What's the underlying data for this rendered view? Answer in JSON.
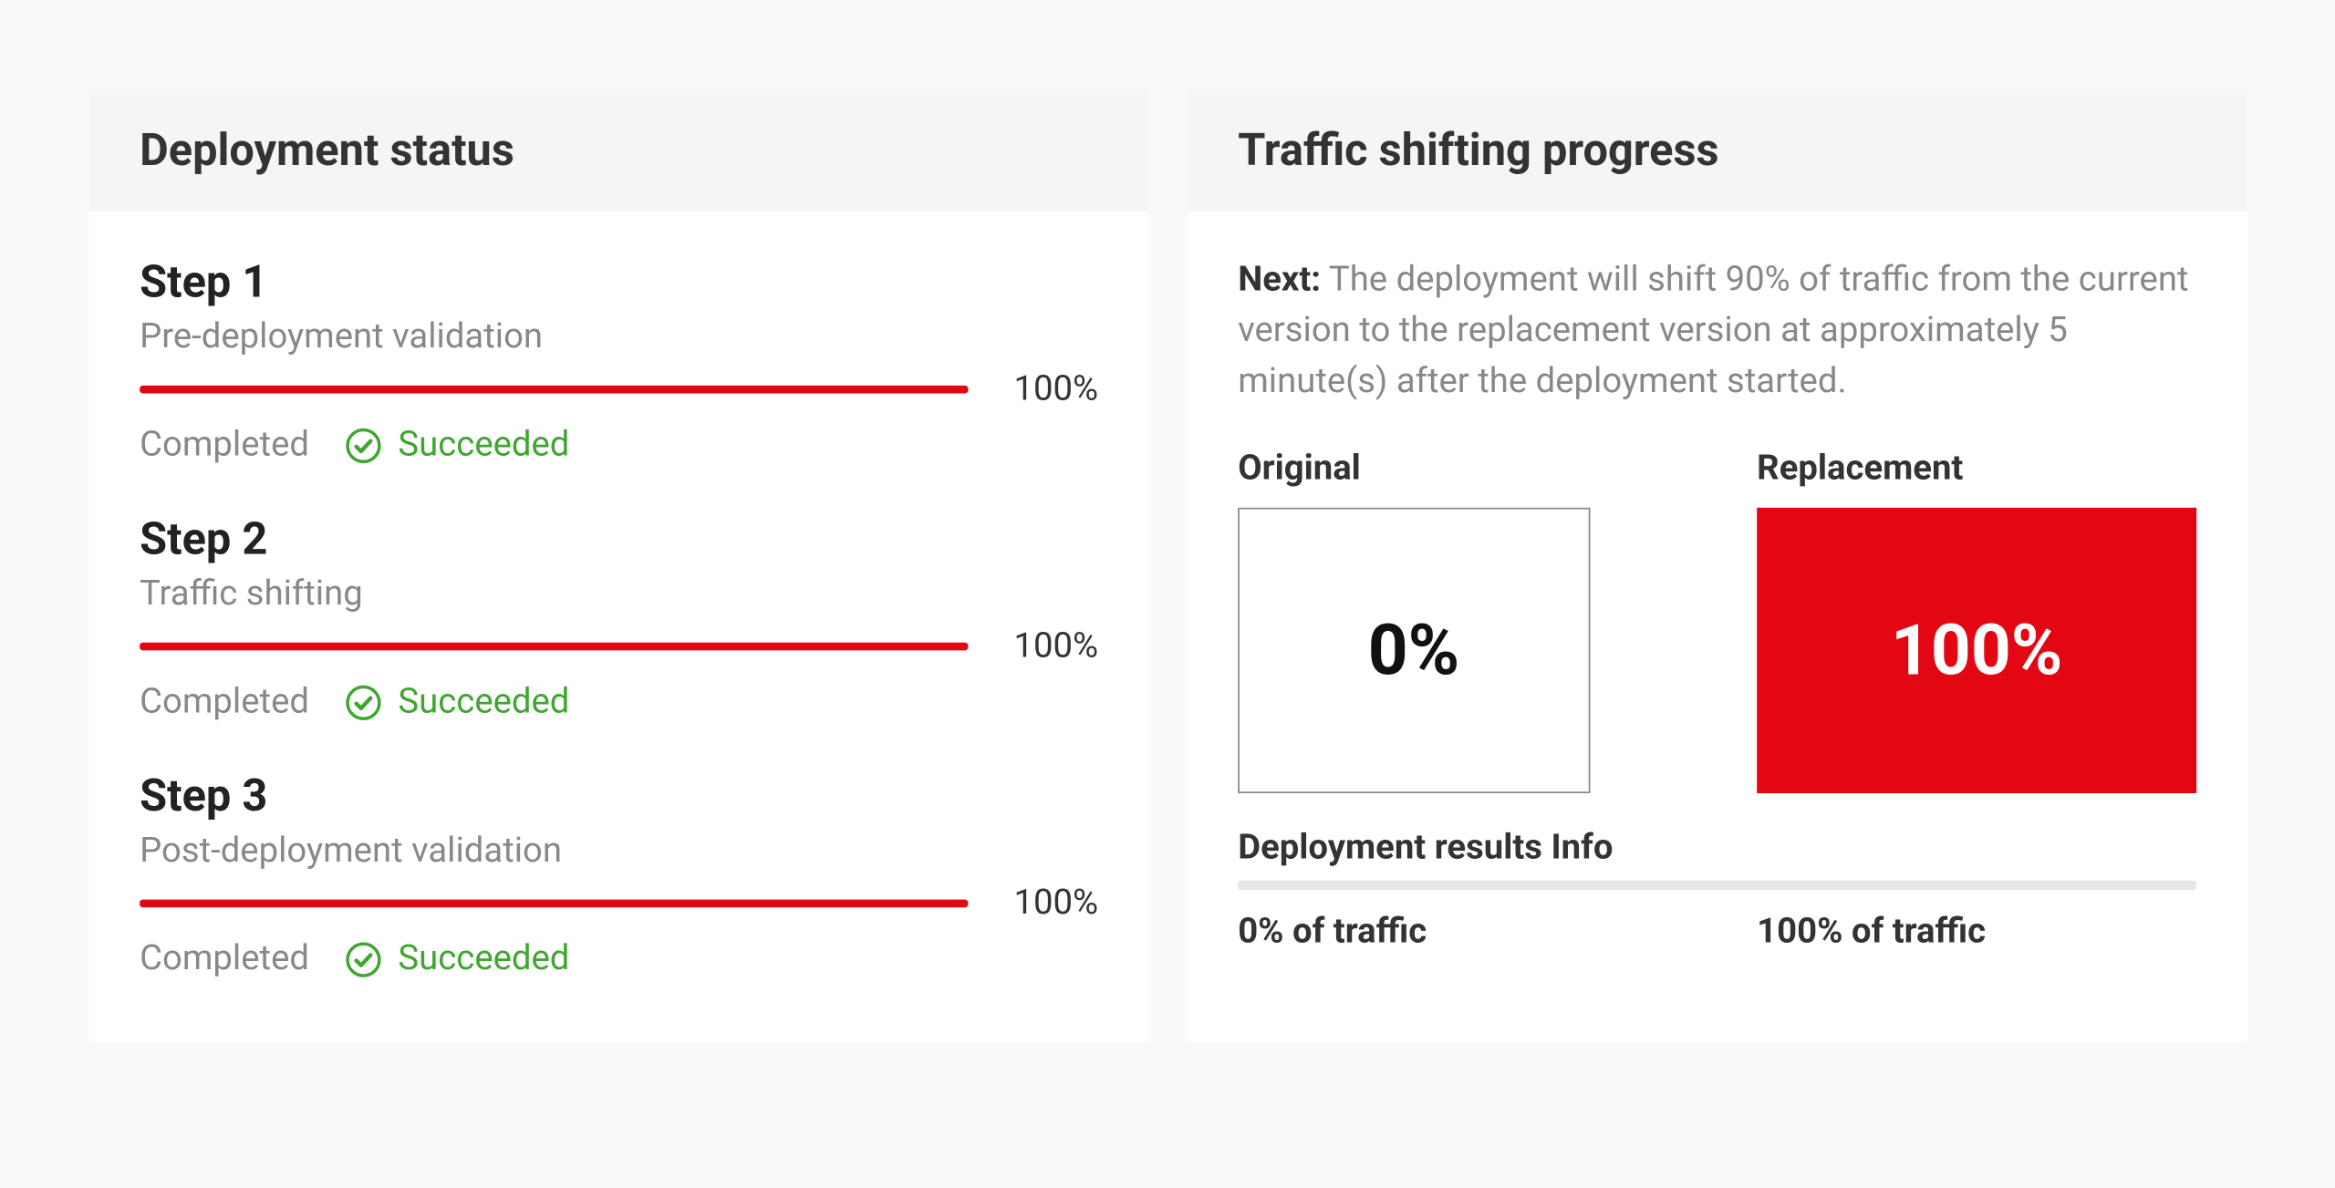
{
  "deployment_status": {
    "title": "Deployment status",
    "steps": [
      {
        "title": "Step 1",
        "subtitle": "Pre-deployment validation",
        "percent": "100%",
        "completed_label": "Completed",
        "success_label": "Succeeded"
      },
      {
        "title": "Step 2",
        "subtitle": "Traffic shifting",
        "percent": "100%",
        "completed_label": "Completed",
        "success_label": "Succeeded"
      },
      {
        "title": "Step 3",
        "subtitle": "Post-deployment validation",
        "percent": "100%",
        "completed_label": "Completed",
        "success_label": "Succeeded"
      }
    ]
  },
  "traffic": {
    "title": "Traffic shifting progress",
    "next_label": "Next:",
    "next_text": " The deployment will shift 90% of traffic from the current version to the replacement version at approximately 5 minute(s) after the deployment started.",
    "original_label": "Original",
    "original_value": "0%",
    "replacement_label": "Replacement",
    "replacement_value": "100%",
    "results_label": "Deployment results Info",
    "original_traffic": "0% of traffic",
    "replacement_traffic": "100% of traffic"
  },
  "colors": {
    "accent_red": "#e30613",
    "success_green": "#3fa62f",
    "text_muted": "#888888",
    "text_primary": "#333333"
  }
}
